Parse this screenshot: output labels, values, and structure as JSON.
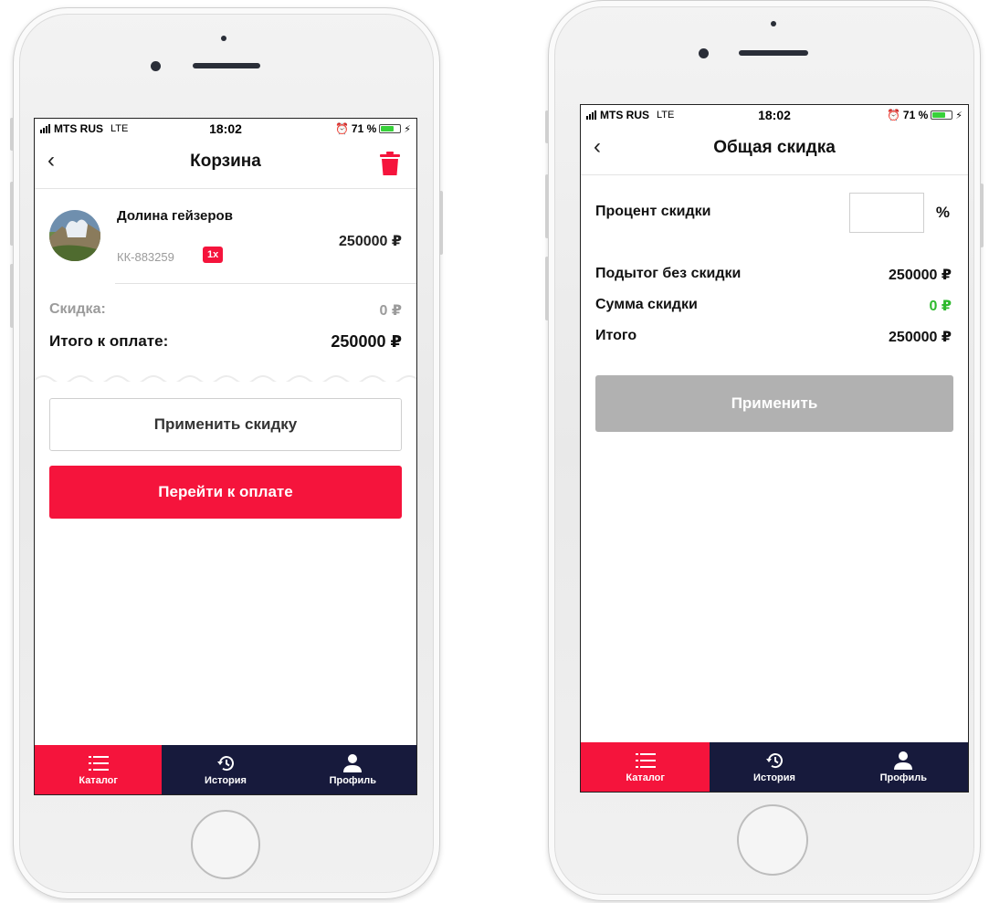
{
  "status_bar": {
    "carrier": "MTS RUS",
    "network": "LTE",
    "time": "18:02",
    "battery_percent": "71 %",
    "battery_level": 0.71
  },
  "cart_screen": {
    "title": "Корзина",
    "product": {
      "name": "Долина гейзеров",
      "code": "КК-883259",
      "quantity": "1x",
      "price": "250000 ₽"
    },
    "discount_label": "Скидка:",
    "discount_value": "0 ₽",
    "total_label": "Итого к оплате:",
    "total_value": "250000 ₽",
    "apply_discount_label": "Применить скидку",
    "checkout_label": "Перейти к оплате"
  },
  "discount_screen": {
    "title": "Общая скидка",
    "percent_label": "Процент скидки",
    "percent_value": "",
    "percent_sign": "%",
    "subtotal_label": "Подытог без скидки",
    "subtotal_value": "250000 ₽",
    "discount_sum_label": "Сумма скидки",
    "discount_sum_value": "0 ₽",
    "total_label": "Итого",
    "total_value": "250000 ₽",
    "apply_label": "Применить"
  },
  "tabbar": {
    "items": [
      {
        "label": "Каталог",
        "icon": "list-icon",
        "active": true
      },
      {
        "label": "История",
        "icon": "history-icon",
        "active": false
      },
      {
        "label": "Профиль",
        "icon": "user-icon",
        "active": false
      }
    ]
  },
  "colors": {
    "accent": "#f5143c",
    "tabbar_bg": "#171a3c",
    "discount_green": "#2db92d",
    "disabled_button": "#b1b1b1"
  }
}
